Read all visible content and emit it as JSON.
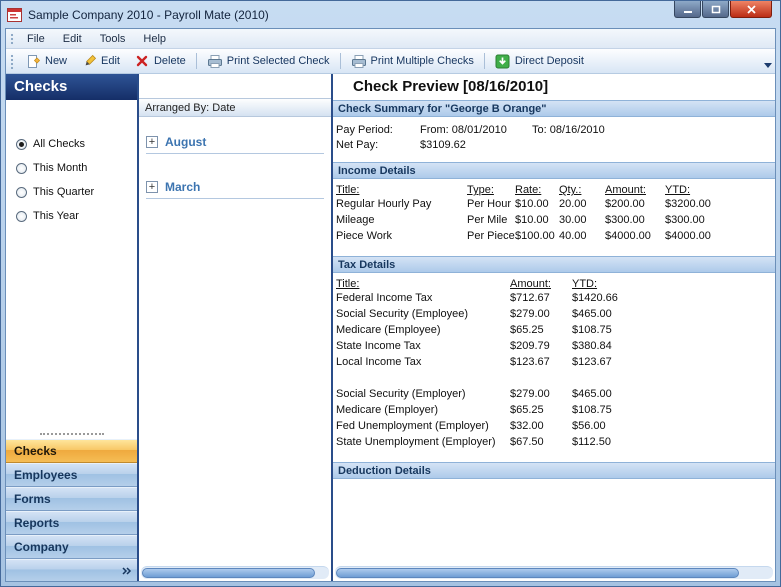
{
  "window": {
    "title": "Sample Company 2010 - Payroll Mate (2010)"
  },
  "menu": {
    "items": [
      "File",
      "Edit",
      "Tools",
      "Help"
    ]
  },
  "toolbar": {
    "items": [
      {
        "label": "New",
        "icon": "new-icon"
      },
      {
        "label": "Edit",
        "icon": "edit-icon"
      },
      {
        "label": "Delete",
        "icon": "delete-icon"
      },
      {
        "label": "Print Selected Check",
        "icon": "printer-icon"
      },
      {
        "label": "Print Multiple Checks",
        "icon": "printer-icon"
      },
      {
        "label": "Direct Deposit",
        "icon": "direct-deposit-icon"
      }
    ]
  },
  "icons": {
    "expand": "+"
  },
  "sidebar": {
    "title": "Checks",
    "filters": [
      {
        "label": "All Checks",
        "selected": true
      },
      {
        "label": "This Month",
        "selected": false
      },
      {
        "label": "This Quarter",
        "selected": false
      },
      {
        "label": "This Year",
        "selected": false
      }
    ],
    "nav": [
      {
        "label": "Checks",
        "active": true
      },
      {
        "label": "Employees",
        "active": false
      },
      {
        "label": "Forms",
        "active": false
      },
      {
        "label": "Reports",
        "active": false
      },
      {
        "label": "Company",
        "active": false
      }
    ]
  },
  "list_panel": {
    "header": "Arranged By: Date",
    "groups": [
      "August",
      "March"
    ]
  },
  "preview": {
    "title": "Check Preview [08/16/2010]",
    "summary_header": "Check Summary for \"George B Orange\"",
    "pay_period_label": "Pay Period:",
    "pay_period_from": "From: 08/01/2010",
    "pay_period_to": "To: 08/16/2010",
    "net_pay_label": "Net Pay:",
    "net_pay_value": "$3109.62",
    "income": {
      "header": "Income Details",
      "columns": [
        "Title:",
        "Type:",
        "Rate:",
        "Qty.:",
        "Amount:",
        "YTD:"
      ],
      "rows": [
        [
          "Regular Hourly Pay",
          "Per Hour",
          "$10.00",
          "20.00",
          "$200.00",
          "$3200.00"
        ],
        [
          "Mileage",
          "Per Mile",
          "$10.00",
          "30.00",
          "$300.00",
          "$300.00"
        ],
        [
          "Piece Work",
          "Per Piece",
          "$100.00",
          "40.00",
          "$4000.00",
          "$4000.00"
        ]
      ]
    },
    "tax": {
      "header": "Tax Details",
      "columns": [
        "Title:",
        "Amount:",
        "YTD:"
      ],
      "rows": [
        [
          "Federal Income Tax",
          "$712.67",
          "$1420.66"
        ],
        [
          "Social Security (Employee)",
          "$279.00",
          "$465.00"
        ],
        [
          "Medicare (Employee)",
          "$65.25",
          "$108.75"
        ],
        [
          "State Income Tax",
          "$209.79",
          "$380.84"
        ],
        [
          "Local Income Tax",
          "$123.67",
          "$123.67"
        ],
        [
          "",
          "",
          ""
        ],
        [
          "Social Security (Employer)",
          "$279.00",
          "$465.00"
        ],
        [
          "Medicare (Employer)",
          "$65.25",
          "$108.75"
        ],
        [
          "Fed Unemployment (Employer)",
          "$32.00",
          "$56.00"
        ],
        [
          "State Unemployment (Employer)",
          "$67.50",
          "$112.50"
        ]
      ]
    },
    "deduction_header": "Deduction Details"
  }
}
